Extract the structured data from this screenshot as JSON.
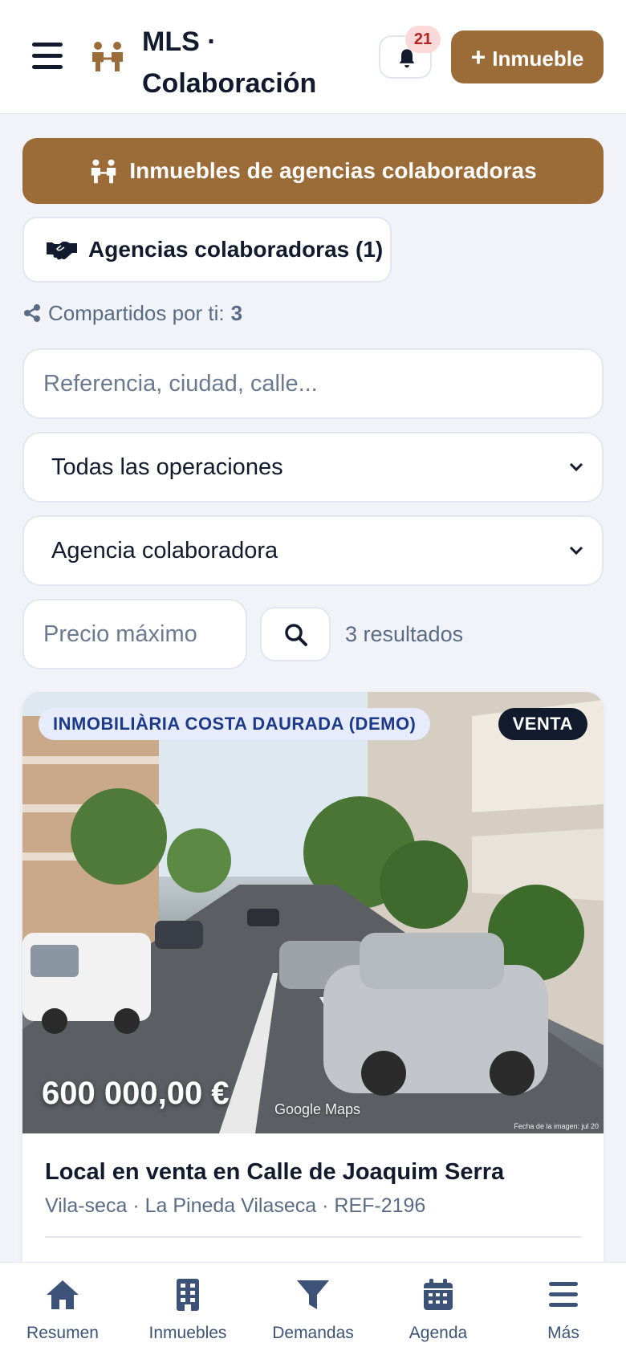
{
  "header": {
    "title": "MLS · Colaboración",
    "notifications_count": "21",
    "add_button_label": "Inmueble",
    "add_button_icon": "plus-icon"
  },
  "banner": {
    "label": "Inmuebles de agencias colaboradoras",
    "icon": "people-icon"
  },
  "agencies_button": {
    "label": "Agencias colaboradoras (1)",
    "icon": "handshake-icon"
  },
  "shared": {
    "label": "Compartidos por ti:",
    "count": "3",
    "icon": "share-icon"
  },
  "filters": {
    "search_placeholder": "Referencia, ciudad, calle...",
    "search_value": "",
    "operation_selected": "Todas las operaciones",
    "agency_selected": "Agencia colaboradora",
    "price_placeholder": "Precio máximo",
    "price_value": "",
    "results_text": "3 resultados"
  },
  "listing": {
    "agency": "INMOBILIÀRIA COSTA DAURADA (DEMO)",
    "operation": "VENTA",
    "price": "600 000,00 €",
    "watermark": "Google Maps",
    "image_date": "Fecha de la imagen: jul 20",
    "title": "Local en venta en Calle de Joaquim Serra",
    "subtitle": "Vila-seca · La Pineda Vilaseca · REF-2196"
  },
  "bottom_nav": [
    {
      "label": "Resumen",
      "icon": "home-icon"
    },
    {
      "label": "Inmuebles",
      "icon": "building-icon"
    },
    {
      "label": "Demandas",
      "icon": "filter-icon"
    },
    {
      "label": "Agenda",
      "icon": "calendar-icon"
    },
    {
      "label": "Más",
      "icon": "menu-icon"
    }
  ],
  "colors": {
    "brand": "#9b6b38",
    "dark": "#121a2e",
    "muted": "#5a6b85",
    "badge_bg": "#fcd9d9",
    "badge_text": "#b42222",
    "agency_tag_bg": "#e6ecfb",
    "agency_tag_text": "#1d3a8a"
  }
}
